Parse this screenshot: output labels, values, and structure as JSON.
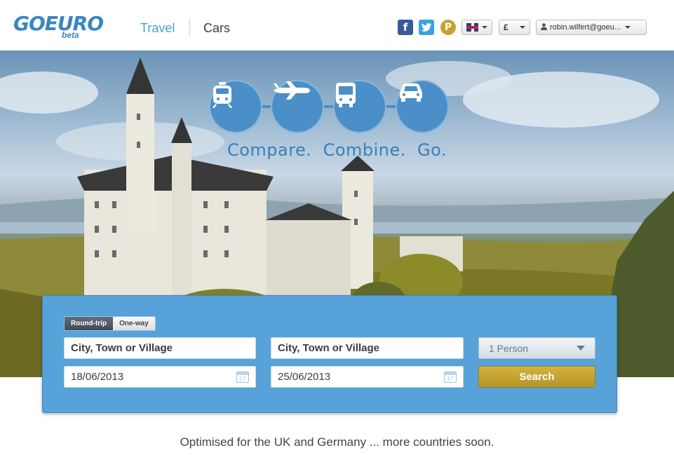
{
  "header": {
    "logo": "GOEURO",
    "logo_sub": "beta",
    "nav": [
      {
        "label": "Travel"
      },
      {
        "label": "Cars"
      }
    ],
    "social": {
      "facebook": "f",
      "twitter": "t",
      "pinterest": "P"
    },
    "currency": "£",
    "user_email": "robin.wilfert@goeu..."
  },
  "hero": {
    "tagline": [
      "Compare.",
      "Combine.",
      "Go."
    ],
    "modes": [
      "train-icon",
      "plane-icon",
      "bus-icon",
      "car-icon"
    ]
  },
  "search": {
    "trip_types": [
      "Round-trip",
      "One-way"
    ],
    "selected_trip_type": "Round-trip",
    "from_placeholder": "City, Town or Village",
    "to_placeholder": "City, Town or Village",
    "depart_date": "18/06/2013",
    "return_date": "25/06/2013",
    "calendar_day": "17",
    "passengers": "1 Person",
    "search_label": "Search"
  },
  "footer": {
    "note": "Optimised for the UK and Germany ... more countries soon."
  },
  "colors": {
    "brand_blue": "#3a86bf",
    "panel_blue": "#57a2d8",
    "search_gold": "#c8a535"
  }
}
